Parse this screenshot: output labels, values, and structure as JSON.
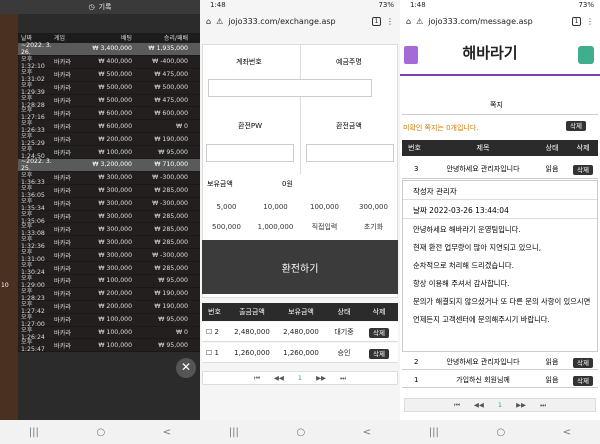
{
  "panel1": {
    "title": "기록",
    "headers": [
      "날짜",
      "게임",
      "",
      "배팅",
      "승리/패배"
    ],
    "rows": [
      {
        "date": true,
        "c1": "~2022. 3. 26.",
        "c2": "",
        "c3": "₩ 3,400,000",
        "c4": "₩ 1,935,000"
      },
      {
        "c1": "오후 1:32:10",
        "c2": "바카라",
        "c3": "₩ 400,000",
        "c4": "₩ -400,000"
      },
      {
        "c1": "오후 1:31:02",
        "c2": "바카라",
        "c3": "₩ 500,000",
        "c4": "₩ 475,000"
      },
      {
        "c1": "오후 1:29:39",
        "c2": "바카라",
        "c3": "₩ 500,000",
        "c4": "₩ 500,000"
      },
      {
        "c1": "오후 1:28:28",
        "c2": "바카라",
        "c3": "₩ 500,000",
        "c4": "₩ 475,000"
      },
      {
        "c1": "오후 1:27:16",
        "c2": "바카라",
        "c3": "₩ 600,000",
        "c4": "₩ 600,000"
      },
      {
        "c1": "오후 1:26:33",
        "c2": "바카라",
        "c3": "₩ 600,000",
        "c4": "₩ 0"
      },
      {
        "c1": "오후 1:25:29",
        "c2": "바카라",
        "c3": "₩ 200,000",
        "c4": "₩ 190,000"
      },
      {
        "c1": "오후 1:24:50",
        "c2": "바카라",
        "c3": "₩ 100,000",
        "c4": "₩ 95,000"
      },
      {
        "date": true,
        "c1": "~2022. 3. 25.",
        "c2": "",
        "c3": "₩ 3,200,000",
        "c4": "₩ 710,000"
      },
      {
        "c1": "오후 1:36:33",
        "c2": "바카라",
        "c3": "₩ 300,000",
        "c4": "₩ -300,000"
      },
      {
        "c1": "오후 1:36:05",
        "c2": "바카라",
        "c3": "₩ 300,000",
        "c4": "₩ 285,000"
      },
      {
        "c1": "오후 1:35:34",
        "c2": "바카라",
        "c3": "₩ 300,000",
        "c4": "₩ -300,000"
      },
      {
        "c1": "오후 1:35:06",
        "c2": "바카라",
        "c3": "₩ 300,000",
        "c4": "₩ 285,000"
      },
      {
        "c1": "오후 1:33:08",
        "c2": "바카라",
        "c3": "₩ 300,000",
        "c4": "₩ 285,000"
      },
      {
        "c1": "오후 1:32:36",
        "c2": "바카라",
        "c3": "₩ 300,000",
        "c4": "₩ 285,000"
      },
      {
        "c1": "오후 1:31:00",
        "c2": "바카라",
        "c3": "₩ 300,000",
        "c4": "₩ -300,000"
      },
      {
        "c1": "오후 1:30:24",
        "c2": "바카라",
        "c3": "₩ 300,000",
        "c4": "₩ 285,000"
      },
      {
        "c1": "오후 1:29:00",
        "c2": "바카라",
        "c3": "₩ 100,000",
        "c4": "₩ 95,000"
      },
      {
        "c1": "오후 1:28:23",
        "c2": "바카라",
        "c3": "₩ 200,000",
        "c4": "₩ 190,000"
      },
      {
        "c1": "오후 1:27:42",
        "c2": "바카라",
        "c3": "₩ 200,000",
        "c4": "₩ 190,000"
      },
      {
        "c1": "오후 1:27:00",
        "c2": "바카라",
        "c3": "₩ 100,000",
        "c4": "₩ 95,000"
      },
      {
        "c1": "오후 1:26:24",
        "c2": "바카라",
        "c3": "₩ 100,000",
        "c4": "₩ 0"
      },
      {
        "c1": "오후 1:25:47",
        "c2": "바카라",
        "c3": "₩ 100,000",
        "c4": "₩ 95,000"
      }
    ],
    "close": "✕",
    "left_digits": "10"
  },
  "panel2": {
    "status_time": "1:48",
    "battery": "73%",
    "url": "jojo333.com/exchange.asp",
    "tabs": "1",
    "labels": {
      "account": "계좌번호",
      "holder": "예금주명",
      "pw": "환전PW",
      "amount": "환전금액",
      "balance_label": "보유금액",
      "balance_value": "0원"
    },
    "amounts_row1": [
      "5,000",
      "10,000",
      "100,000",
      "300,000"
    ],
    "amounts_row2": [
      "500,000",
      "1,000,000",
      "직접입력",
      "초기화"
    ],
    "submit": "환전하기",
    "table_headers": [
      "번호",
      "출금금액",
      "보유금액",
      "상태",
      "삭제"
    ],
    "rows": [
      {
        "no": "2",
        "out": "2,480,000",
        "hold": "2,480,000",
        "state": "대기중",
        "del": "삭제"
      },
      {
        "no": "1",
        "out": "1,260,000",
        "hold": "1,260,000",
        "state": "승인",
        "del": "삭제"
      }
    ],
    "pager": [
      "⏮",
      "◀◀",
      "1",
      "▶▶",
      "⏭"
    ]
  },
  "panel3": {
    "status_time": "1:48",
    "battery": "73%",
    "url": "jojo333.com/message.asp",
    "tabs": "1",
    "logo": "해바라기",
    "page_title": "쪽지",
    "unread": "미확인 쪽지는 0개입니다.",
    "delete_label": "삭제",
    "table_headers": [
      "번호",
      "제목",
      "상태",
      "삭제"
    ],
    "row3": {
      "no": "3",
      "title": "안녕하세요 관리자입니다",
      "state": "읽음",
      "del": "삭제"
    },
    "author": "작성자 관리자",
    "date": "날짜   2022-03-26 13:44:04",
    "body": [
      "안녕하세요 해바라기 운영팀입니다.",
      "현재 환전 업무량이 많아 지연되고 있으니,",
      "순차적으로 처리해 드리겠습니다.",
      "항상 이용해 주셔서 감사합니다.",
      "문의가 해결되지 않으셨거나 또 다른 문의 사항이 있으시면",
      "언제든지 고객센터에 문의해주시기 바랍니다."
    ],
    "row2": {
      "no": "2",
      "title": "안녕하세요 관리자입니다",
      "state": "읽음",
      "del": "삭제"
    },
    "row1": {
      "no": "1",
      "title": "가입하신 회원님께",
      "state": "읽음",
      "del": "삭제"
    },
    "pager": [
      "⏮",
      "◀◀",
      "1",
      "▶▶",
      "⏭"
    ]
  },
  "nav": {
    "recent": "|||",
    "home": "○",
    "back": "<"
  }
}
